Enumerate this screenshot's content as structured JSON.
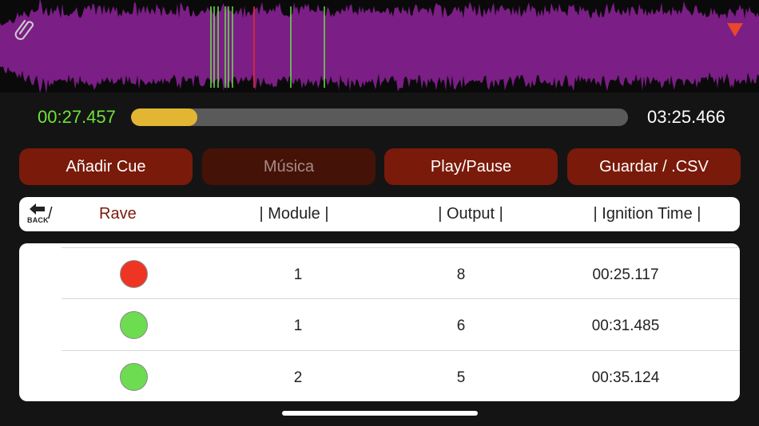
{
  "playback": {
    "current_time": "00:27.457",
    "total_time": "03:25.466",
    "progress": 0.133
  },
  "waveform": {
    "color": "#7b1e85",
    "cue_colors": {
      "fired": "#ee2a2a",
      "pending": "#6be24a"
    }
  },
  "toolbar": {
    "add_cue_label": "Añadir Cue",
    "music_label": "Música",
    "play_pause_label": "Play/Pause",
    "save_label": "Guardar / .CSV"
  },
  "header": {
    "back_label": "BACK",
    "separator": "/",
    "project_name": "Rave",
    "columns": [
      "| Module |",
      "| Output |",
      "| Ignition Time |"
    ]
  },
  "cues": [
    {
      "status": "fired",
      "color": "#ee3524",
      "module": "1",
      "output": "8",
      "ignition_time": "00:25.117"
    },
    {
      "status": "pending",
      "color": "#6ddc50",
      "module": "1",
      "output": "6",
      "ignition_time": "00:31.485"
    },
    {
      "status": "pending",
      "color": "#6ddc50",
      "module": "2",
      "output": "5",
      "ignition_time": "00:35.124"
    }
  ]
}
